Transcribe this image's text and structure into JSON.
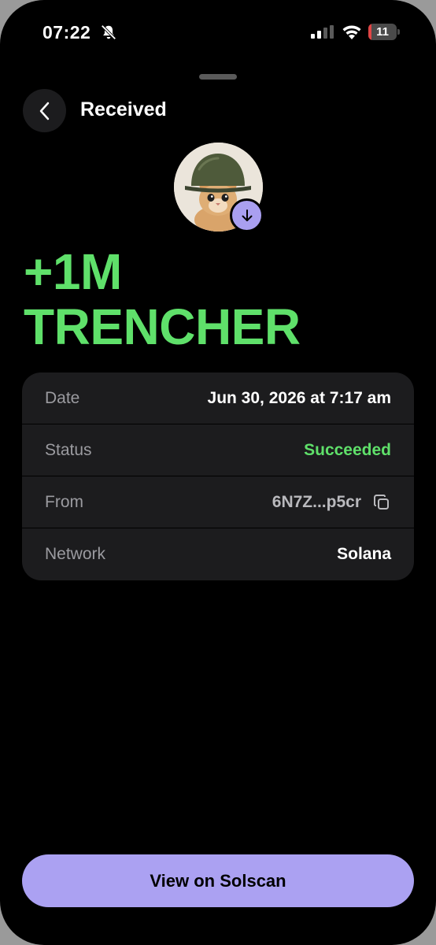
{
  "status_bar": {
    "time": "07:22",
    "battery_level": "11",
    "battery_fraction": 0.11,
    "battery_color": "#e04545",
    "icons": [
      "bell-slash-icon",
      "signal-icon",
      "wifi-icon",
      "battery-icon"
    ]
  },
  "header": {
    "back_icon": "chevron-left-icon",
    "title": "Received"
  },
  "token": {
    "avatar": "cat-with-helmet-avatar",
    "badge_icon": "arrow-down-icon",
    "badge_color": "#a99ff0"
  },
  "amount": {
    "value": "+1M",
    "symbol": "TRENCHER",
    "color": "#5fe06a"
  },
  "details": [
    {
      "label": "Date",
      "value": "Jun 30, 2026 at 7:17 am"
    },
    {
      "label": "Status",
      "value": "Succeeded"
    },
    {
      "label": "From",
      "value": "6N7Z...p5cr",
      "icon": "copy-icon"
    },
    {
      "label": "Network",
      "value": "Solana"
    }
  ],
  "actions": {
    "view_button": "View on Solscan",
    "button_color": "#aba1f2"
  }
}
